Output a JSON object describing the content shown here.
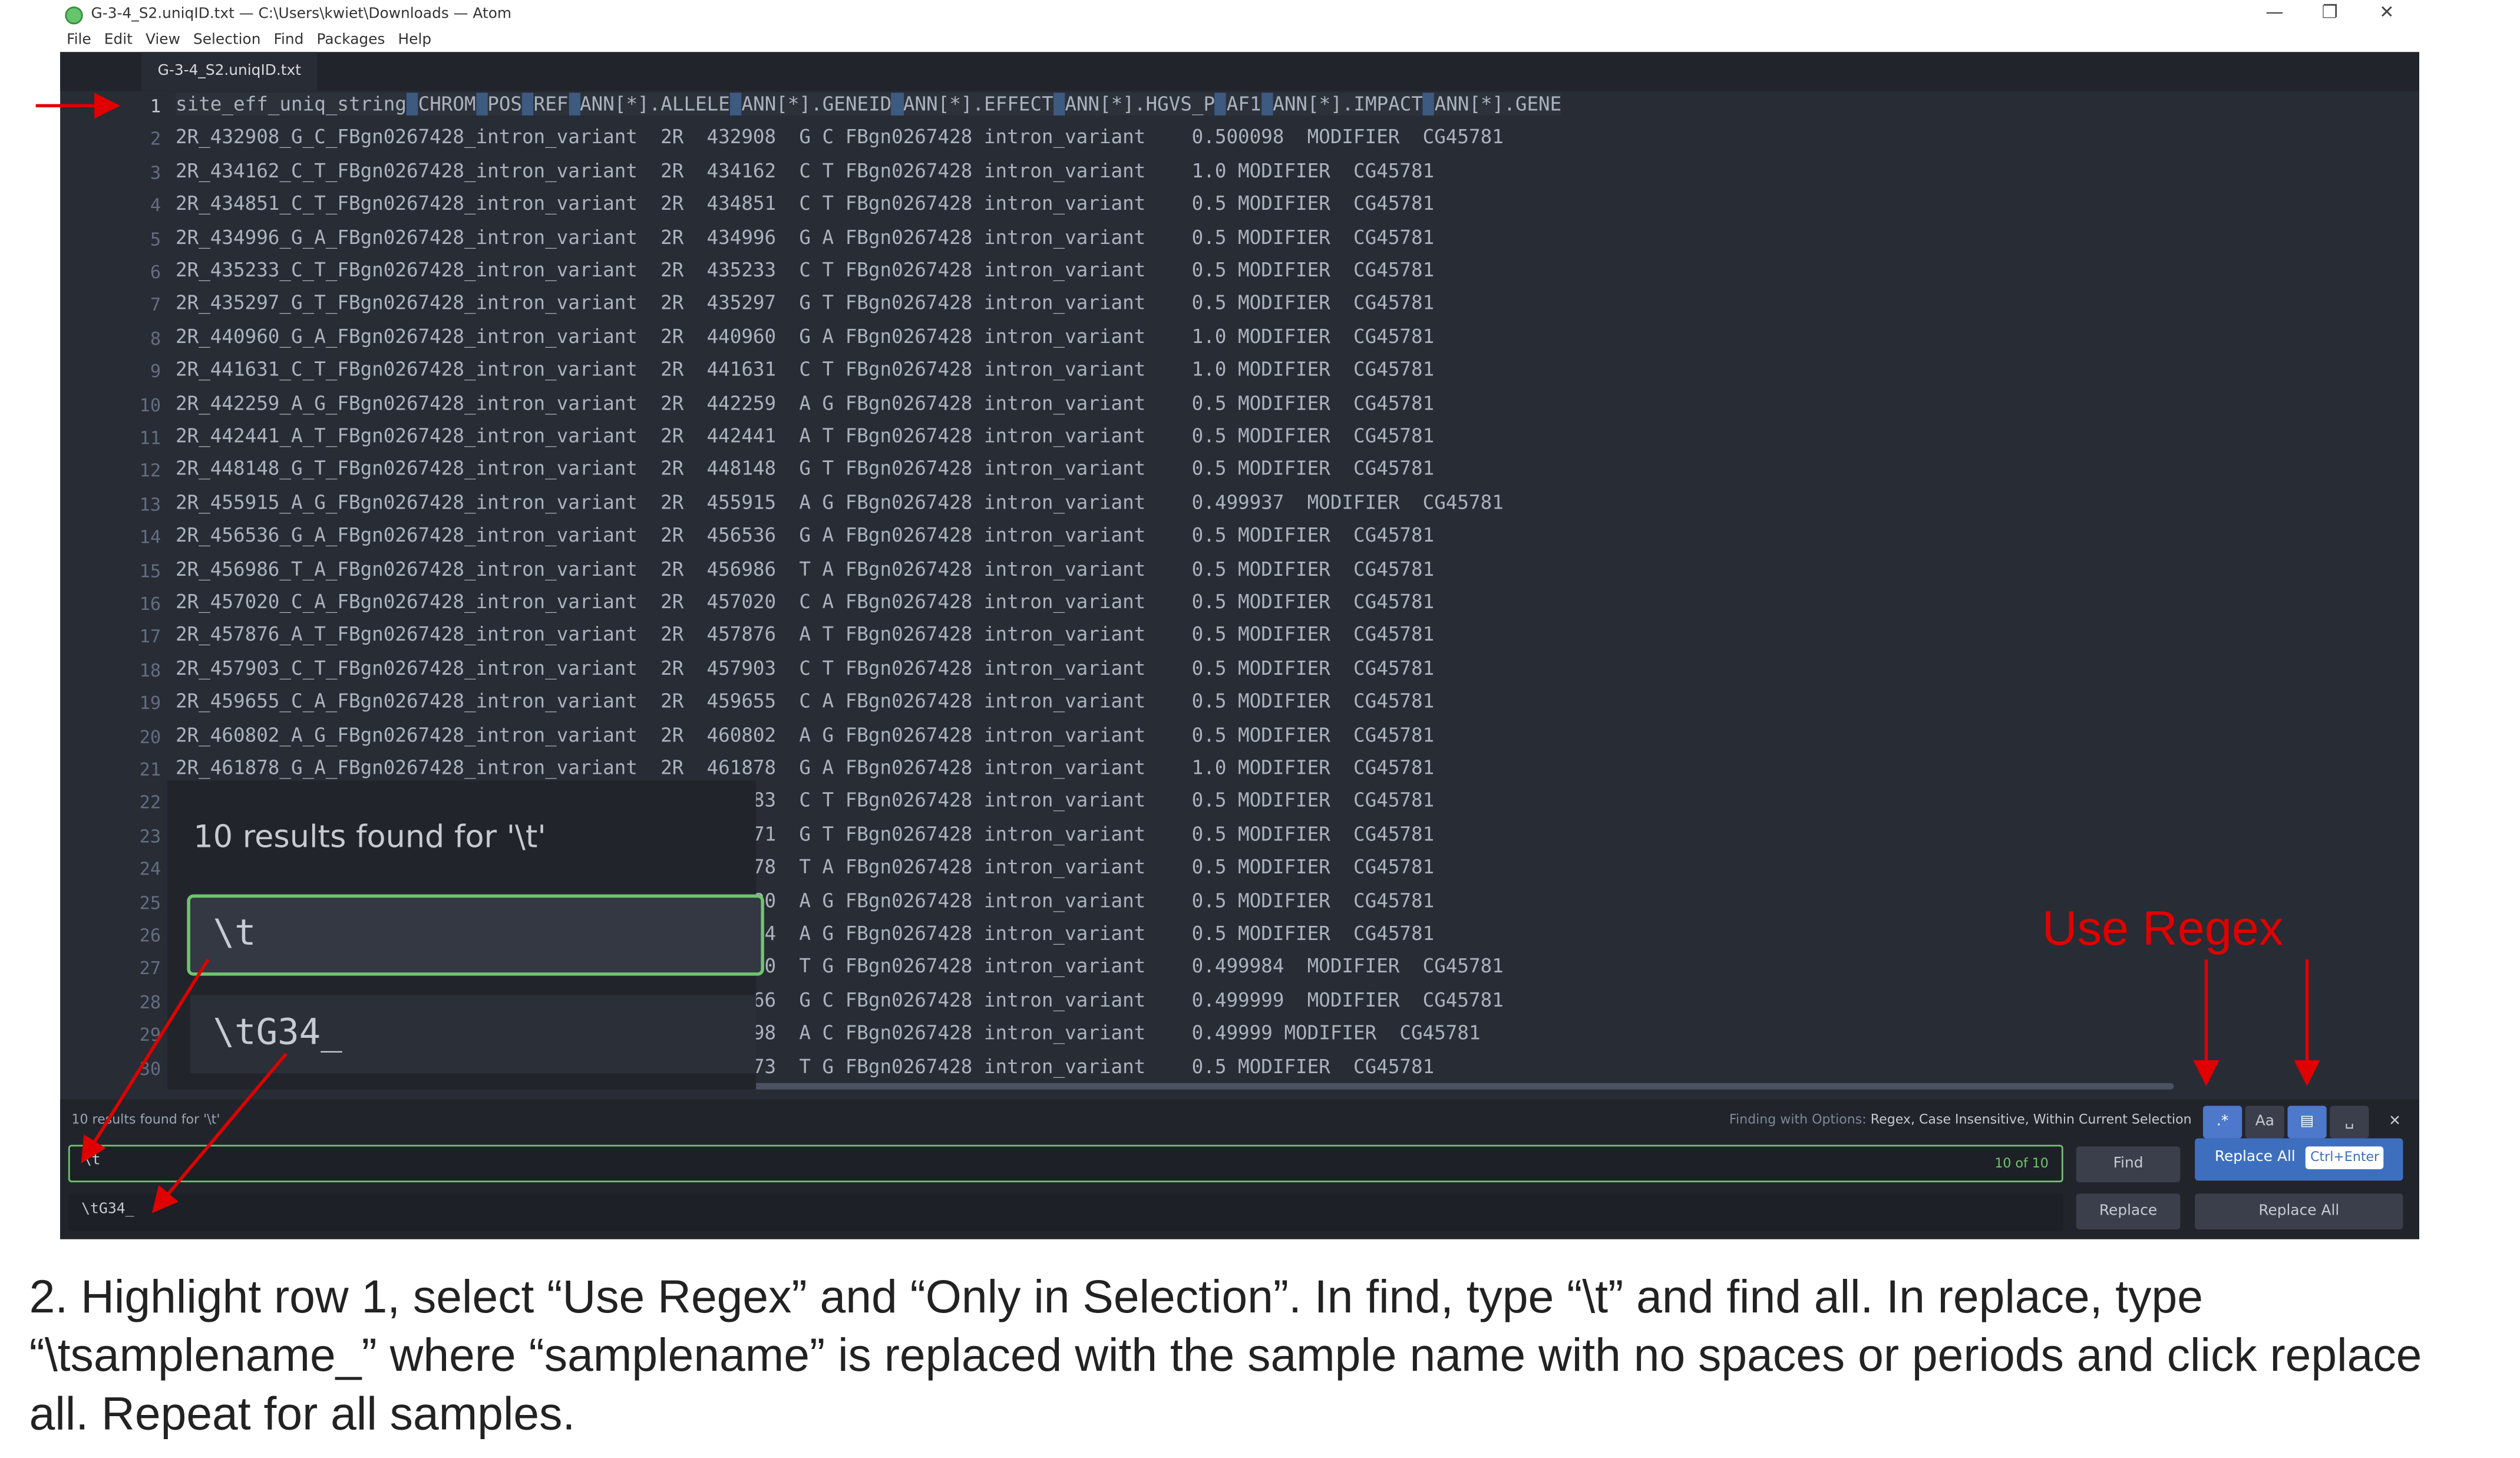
{
  "window": {
    "title": "G-3-4_S2.uniqID.txt — C:\\Users\\kwiet\\Downloads — Atom",
    "minimize": "—",
    "maximize": "❐",
    "close": "✕"
  },
  "menu": [
    "File",
    "Edit",
    "View",
    "Selection",
    "Find",
    "Packages",
    "Help"
  ],
  "tab": {
    "label": "G-3-4_S2.uniqID.txt"
  },
  "editor": {
    "header_line": "site_eff_uniq_string CHROM POS REF ANN[*].ALLELE ANN[*].GENEID ANN[*].EFFECT ANN[*].HGVS_P AF1 ANN[*].IMPACT ANN[*].GENE",
    "lines": [
      "2R_432908_G_C_FBgn0267428_intron_variant  2R  432908  G C FBgn0267428 intron_variant    0.500098  MODIFIER  CG45781",
      "2R_434162_C_T_FBgn0267428_intron_variant  2R  434162  C T FBgn0267428 intron_variant    1.0 MODIFIER  CG45781",
      "2R_434851_C_T_FBgn0267428_intron_variant  2R  434851  C T FBgn0267428 intron_variant    0.5 MODIFIER  CG45781",
      "2R_434996_G_A_FBgn0267428_intron_variant  2R  434996  G A FBgn0267428 intron_variant    0.5 MODIFIER  CG45781",
      "2R_435233_C_T_FBgn0267428_intron_variant  2R  435233  C T FBgn0267428 intron_variant    0.5 MODIFIER  CG45781",
      "2R_435297_G_T_FBgn0267428_intron_variant  2R  435297  G T FBgn0267428 intron_variant    0.5 MODIFIER  CG45781",
      "2R_440960_G_A_FBgn0267428_intron_variant  2R  440960  G A FBgn0267428 intron_variant    1.0 MODIFIER  CG45781",
      "2R_441631_C_T_FBgn0267428_intron_variant  2R  441631  C T FBgn0267428 intron_variant    1.0 MODIFIER  CG45781",
      "2R_442259_A_G_FBgn0267428_intron_variant  2R  442259  A G FBgn0267428 intron_variant    0.5 MODIFIER  CG45781",
      "2R_442441_A_T_FBgn0267428_intron_variant  2R  442441  A T FBgn0267428 intron_variant    0.5 MODIFIER  CG45781",
      "2R_448148_G_T_FBgn0267428_intron_variant  2R  448148  G T FBgn0267428 intron_variant    0.5 MODIFIER  CG45781",
      "2R_455915_A_G_FBgn0267428_intron_variant  2R  455915  A G FBgn0267428 intron_variant    0.499937  MODIFIER  CG45781",
      "2R_456536_G_A_FBgn0267428_intron_variant  2R  456536  G A FBgn0267428 intron_variant    0.5 MODIFIER  CG45781",
      "2R_456986_T_A_FBgn0267428_intron_variant  2R  456986  T A FBgn0267428 intron_variant    0.5 MODIFIER  CG45781",
      "2R_457020_C_A_FBgn0267428_intron_variant  2R  457020  C A FBgn0267428 intron_variant    0.5 MODIFIER  CG45781",
      "2R_457876_A_T_FBgn0267428_intron_variant  2R  457876  A T FBgn0267428 intron_variant    0.5 MODIFIER  CG45781",
      "2R_457903_C_T_FBgn0267428_intron_variant  2R  457903  C T FBgn0267428 intron_variant    0.5 MODIFIER  CG45781",
      "2R_459655_C_A_FBgn0267428_intron_variant  2R  459655  C A FBgn0267428 intron_variant    0.5 MODIFIER  CG45781",
      "2R_460802_A_G_FBgn0267428_intron_variant  2R  460802  A G FBgn0267428 intron_variant    0.5 MODIFIER  CG45781",
      "2R_461878_G_A_FBgn0267428_intron_variant  2R  461878  G A FBgn0267428 intron_variant    1.0 MODIFIER  CG45781",
      "                                               61983  C T FBgn0267428 intron_variant    0.5 MODIFIER  CG45781",
      "                                               64171  G T FBgn0267428 intron_variant    0.5 MODIFIER  CG45781",
      "                                               66778  T A FBgn0267428 intron_variant    0.5 MODIFIER  CG45781",
      "                                               67880  A G FBgn0267428 intron_variant    0.5 MODIFIER  CG45781",
      "                                               69544  A G FBgn0267428 intron_variant    0.5 MODIFIER  CG45781",
      "                                               69650  T G FBgn0267428 intron_variant    0.499984  MODIFIER  CG45781",
      "                                               69666  G C FBgn0267428 intron_variant    0.499999  MODIFIER  CG45781",
      "                                               69698  A C FBgn0267428 intron_variant    0.49999 MODIFIER  CG45781",
      "                                               69873  T G FBgn0267428 intron_variant    0.5 MODIFIER  CG45781"
    ]
  },
  "zoom": {
    "results": "10 results found for '\\t'",
    "find": "\\t",
    "replace": "\\tG34_"
  },
  "find_panel": {
    "results": "10 results found for '\\t'",
    "options_prefix": "Finding with Options: ",
    "options": "Regex, Case Insensitive, Within Current Selection",
    "find_value": "\\t",
    "count": "10 of 10",
    "replace_value": "\\tG34_",
    "find_button": "Find",
    "replace_button": "Replace",
    "replace_all_button": "Replace All",
    "tooltip_label": "Replace All",
    "tooltip_shortcut": "Ctrl+Enter",
    "opt_regex": ".*",
    "opt_case": "Aa",
    "opt_selection": "▤",
    "opt_word": "␣",
    "close": "✕"
  },
  "annotation": {
    "use_regex": "Use Regex"
  },
  "instruction": "2. Highlight row 1, select “Use Regex” and “Only in Selection”. In find, type “\\t” and find all. In replace, type “\\tsamplename_” where “samplename” is replaced with the sample name with no spaces or periods and click replace all. Repeat for all samples.",
  "colors": {
    "accent": "#e00000",
    "found": "#6ec56e",
    "primary": "#3e6fbf"
  }
}
